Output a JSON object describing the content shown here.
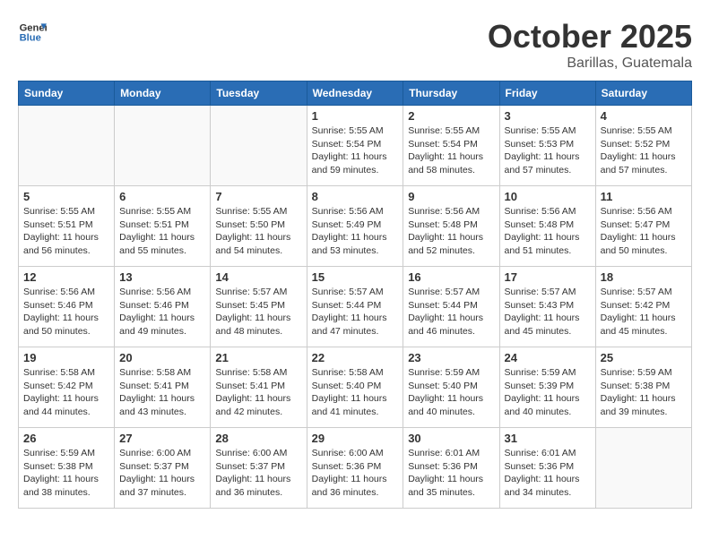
{
  "header": {
    "logo_line1": "General",
    "logo_line2": "Blue",
    "month": "October 2025",
    "location": "Barillas, Guatemala"
  },
  "weekdays": [
    "Sunday",
    "Monday",
    "Tuesday",
    "Wednesday",
    "Thursday",
    "Friday",
    "Saturday"
  ],
  "weeks": [
    [
      {
        "day": "",
        "info": ""
      },
      {
        "day": "",
        "info": ""
      },
      {
        "day": "",
        "info": ""
      },
      {
        "day": "1",
        "info": "Sunrise: 5:55 AM\nSunset: 5:54 PM\nDaylight: 11 hours\nand 59 minutes."
      },
      {
        "day": "2",
        "info": "Sunrise: 5:55 AM\nSunset: 5:54 PM\nDaylight: 11 hours\nand 58 minutes."
      },
      {
        "day": "3",
        "info": "Sunrise: 5:55 AM\nSunset: 5:53 PM\nDaylight: 11 hours\nand 57 minutes."
      },
      {
        "day": "4",
        "info": "Sunrise: 5:55 AM\nSunset: 5:52 PM\nDaylight: 11 hours\nand 57 minutes."
      }
    ],
    [
      {
        "day": "5",
        "info": "Sunrise: 5:55 AM\nSunset: 5:51 PM\nDaylight: 11 hours\nand 56 minutes."
      },
      {
        "day": "6",
        "info": "Sunrise: 5:55 AM\nSunset: 5:51 PM\nDaylight: 11 hours\nand 55 minutes."
      },
      {
        "day": "7",
        "info": "Sunrise: 5:55 AM\nSunset: 5:50 PM\nDaylight: 11 hours\nand 54 minutes."
      },
      {
        "day": "8",
        "info": "Sunrise: 5:56 AM\nSunset: 5:49 PM\nDaylight: 11 hours\nand 53 minutes."
      },
      {
        "day": "9",
        "info": "Sunrise: 5:56 AM\nSunset: 5:48 PM\nDaylight: 11 hours\nand 52 minutes."
      },
      {
        "day": "10",
        "info": "Sunrise: 5:56 AM\nSunset: 5:48 PM\nDaylight: 11 hours\nand 51 minutes."
      },
      {
        "day": "11",
        "info": "Sunrise: 5:56 AM\nSunset: 5:47 PM\nDaylight: 11 hours\nand 50 minutes."
      }
    ],
    [
      {
        "day": "12",
        "info": "Sunrise: 5:56 AM\nSunset: 5:46 PM\nDaylight: 11 hours\nand 50 minutes."
      },
      {
        "day": "13",
        "info": "Sunrise: 5:56 AM\nSunset: 5:46 PM\nDaylight: 11 hours\nand 49 minutes."
      },
      {
        "day": "14",
        "info": "Sunrise: 5:57 AM\nSunset: 5:45 PM\nDaylight: 11 hours\nand 48 minutes."
      },
      {
        "day": "15",
        "info": "Sunrise: 5:57 AM\nSunset: 5:44 PM\nDaylight: 11 hours\nand 47 minutes."
      },
      {
        "day": "16",
        "info": "Sunrise: 5:57 AM\nSunset: 5:44 PM\nDaylight: 11 hours\nand 46 minutes."
      },
      {
        "day": "17",
        "info": "Sunrise: 5:57 AM\nSunset: 5:43 PM\nDaylight: 11 hours\nand 45 minutes."
      },
      {
        "day": "18",
        "info": "Sunrise: 5:57 AM\nSunset: 5:42 PM\nDaylight: 11 hours\nand 45 minutes."
      }
    ],
    [
      {
        "day": "19",
        "info": "Sunrise: 5:58 AM\nSunset: 5:42 PM\nDaylight: 11 hours\nand 44 minutes."
      },
      {
        "day": "20",
        "info": "Sunrise: 5:58 AM\nSunset: 5:41 PM\nDaylight: 11 hours\nand 43 minutes."
      },
      {
        "day": "21",
        "info": "Sunrise: 5:58 AM\nSunset: 5:41 PM\nDaylight: 11 hours\nand 42 minutes."
      },
      {
        "day": "22",
        "info": "Sunrise: 5:58 AM\nSunset: 5:40 PM\nDaylight: 11 hours\nand 41 minutes."
      },
      {
        "day": "23",
        "info": "Sunrise: 5:59 AM\nSunset: 5:40 PM\nDaylight: 11 hours\nand 40 minutes."
      },
      {
        "day": "24",
        "info": "Sunrise: 5:59 AM\nSunset: 5:39 PM\nDaylight: 11 hours\nand 40 minutes."
      },
      {
        "day": "25",
        "info": "Sunrise: 5:59 AM\nSunset: 5:38 PM\nDaylight: 11 hours\nand 39 minutes."
      }
    ],
    [
      {
        "day": "26",
        "info": "Sunrise: 5:59 AM\nSunset: 5:38 PM\nDaylight: 11 hours\nand 38 minutes."
      },
      {
        "day": "27",
        "info": "Sunrise: 6:00 AM\nSunset: 5:37 PM\nDaylight: 11 hours\nand 37 minutes."
      },
      {
        "day": "28",
        "info": "Sunrise: 6:00 AM\nSunset: 5:37 PM\nDaylight: 11 hours\nand 36 minutes."
      },
      {
        "day": "29",
        "info": "Sunrise: 6:00 AM\nSunset: 5:36 PM\nDaylight: 11 hours\nand 36 minutes."
      },
      {
        "day": "30",
        "info": "Sunrise: 6:01 AM\nSunset: 5:36 PM\nDaylight: 11 hours\nand 35 minutes."
      },
      {
        "day": "31",
        "info": "Sunrise: 6:01 AM\nSunset: 5:36 PM\nDaylight: 11 hours\nand 34 minutes."
      },
      {
        "day": "",
        "info": ""
      }
    ]
  ]
}
